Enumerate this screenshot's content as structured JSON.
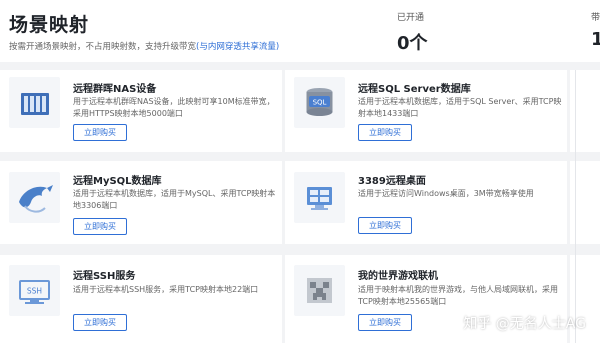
{
  "header": {
    "title": "场景映射",
    "subtitle": "按需开通场景映射，不占用映射数，支持升级带宽",
    "subtitle_link": "(与内网穿透共享流量)",
    "stats": [
      {
        "label": "已开通",
        "value": "0个"
      },
      {
        "label": "带",
        "value": "1"
      }
    ]
  },
  "buy_label": "立即购买",
  "cards": [
    {
      "title": "远程群晖NAS设备",
      "desc": "用于远程本机群晖NAS设备，此映射可享10M标准带宽，采用HTTPS映射本地5000端口",
      "icon": "nas-device-icon"
    },
    {
      "title": "远程SQL Server数据库",
      "desc": "适用于远程本机数据库，适用于SQL Server、采用TCP映射本地1433端口",
      "icon": "sql-server-icon"
    },
    {
      "title": "远程MySQL数据库",
      "desc": "适用于远程本机数据库，适用于MySQL、采用TCP映射本地3306端口",
      "icon": "mysql-dolphin-icon"
    },
    {
      "title": "3389远程桌面",
      "desc": "适用于远程访问Windows桌面，3M带宽畅享使用",
      "icon": "windows-desktop-icon"
    },
    {
      "title": "远程SSH服务",
      "desc": "适用于远程本机SSH服务，采用TCP映射本地22端口",
      "icon": "ssh-terminal-icon"
    },
    {
      "title": "我的世界游戏联机",
      "desc": "适用于映射本机我的世界游戏，与他人局域网联机，采用TCP映射本地25565端口",
      "icon": "minecraft-creeper-icon"
    }
  ],
  "watermark": "知乎 @无名人士AG"
}
